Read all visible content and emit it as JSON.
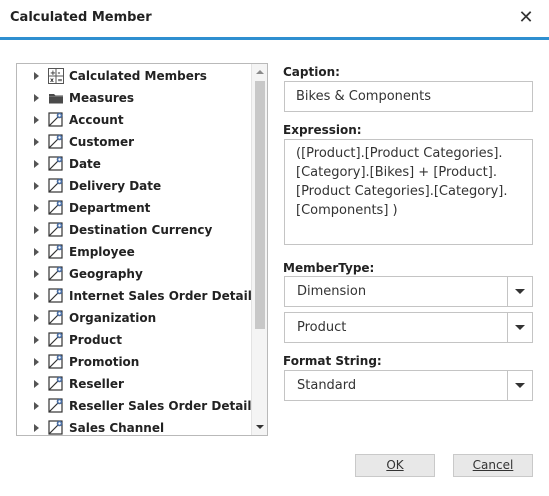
{
  "window": {
    "title": "Calculated Member"
  },
  "tree": {
    "items": [
      {
        "label": "Calculated Members",
        "icon": "calculator-icon"
      },
      {
        "label": "Measures",
        "icon": "folder-icon"
      },
      {
        "label": "Account",
        "icon": "dimension-icon"
      },
      {
        "label": "Customer",
        "icon": "dimension-icon"
      },
      {
        "label": "Date",
        "icon": "dimension-icon"
      },
      {
        "label": "Delivery Date",
        "icon": "dimension-icon"
      },
      {
        "label": "Department",
        "icon": "dimension-icon"
      },
      {
        "label": "Destination Currency",
        "icon": "dimension-icon"
      },
      {
        "label": "Employee",
        "icon": "dimension-icon"
      },
      {
        "label": "Geography",
        "icon": "dimension-icon"
      },
      {
        "label": "Internet Sales Order Details",
        "icon": "dimension-icon"
      },
      {
        "label": "Organization",
        "icon": "dimension-icon"
      },
      {
        "label": "Product",
        "icon": "dimension-icon"
      },
      {
        "label": "Promotion",
        "icon": "dimension-icon"
      },
      {
        "label": "Reseller",
        "icon": "dimension-icon"
      },
      {
        "label": "Reseller Sales Order Details",
        "icon": "dimension-icon"
      },
      {
        "label": "Sales Channel",
        "icon": "dimension-icon"
      }
    ]
  },
  "form": {
    "caption_label": "Caption:",
    "caption_value": "Bikes & Components",
    "expression_label": "Expression:",
    "expression_value": "([Product].[Product Categories].\n[Category].[Bikes] + [Product].\n[Product Categories].[Category].\n[Components] )",
    "membertype_label": "MemberType:",
    "membertype_value": "Dimension",
    "dimension_value": "Product",
    "format_label": "Format String:",
    "format_value": "Standard"
  },
  "buttons": {
    "ok": "OK",
    "cancel": "Cancel"
  },
  "colors": {
    "accent": "#2e8fd0",
    "icon_blue": "#4a6fa5"
  }
}
